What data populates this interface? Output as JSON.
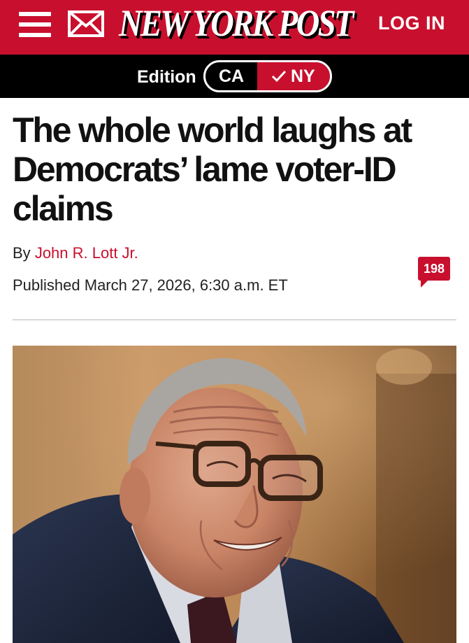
{
  "header": {
    "logo_text": "NEW YORK POST",
    "login_label": "LOG IN",
    "menu_icon": "hamburger-menu-icon",
    "mail_icon": "envelope-icon",
    "brand_color": "#c8102e"
  },
  "edition": {
    "label": "Edition",
    "options": [
      "CA",
      "NY"
    ],
    "selected": "NY",
    "check_icon": "checkmark-icon"
  },
  "article": {
    "headline": "The whole world laughs at Democrats’ lame voter-ID claims",
    "by_prefix": "By",
    "author": "John R. Lott Jr.",
    "published": "Published March 27, 2026, 6:30 a.m. ET",
    "comment_count": "198",
    "comment_icon": "comment-bubble-icon"
  }
}
